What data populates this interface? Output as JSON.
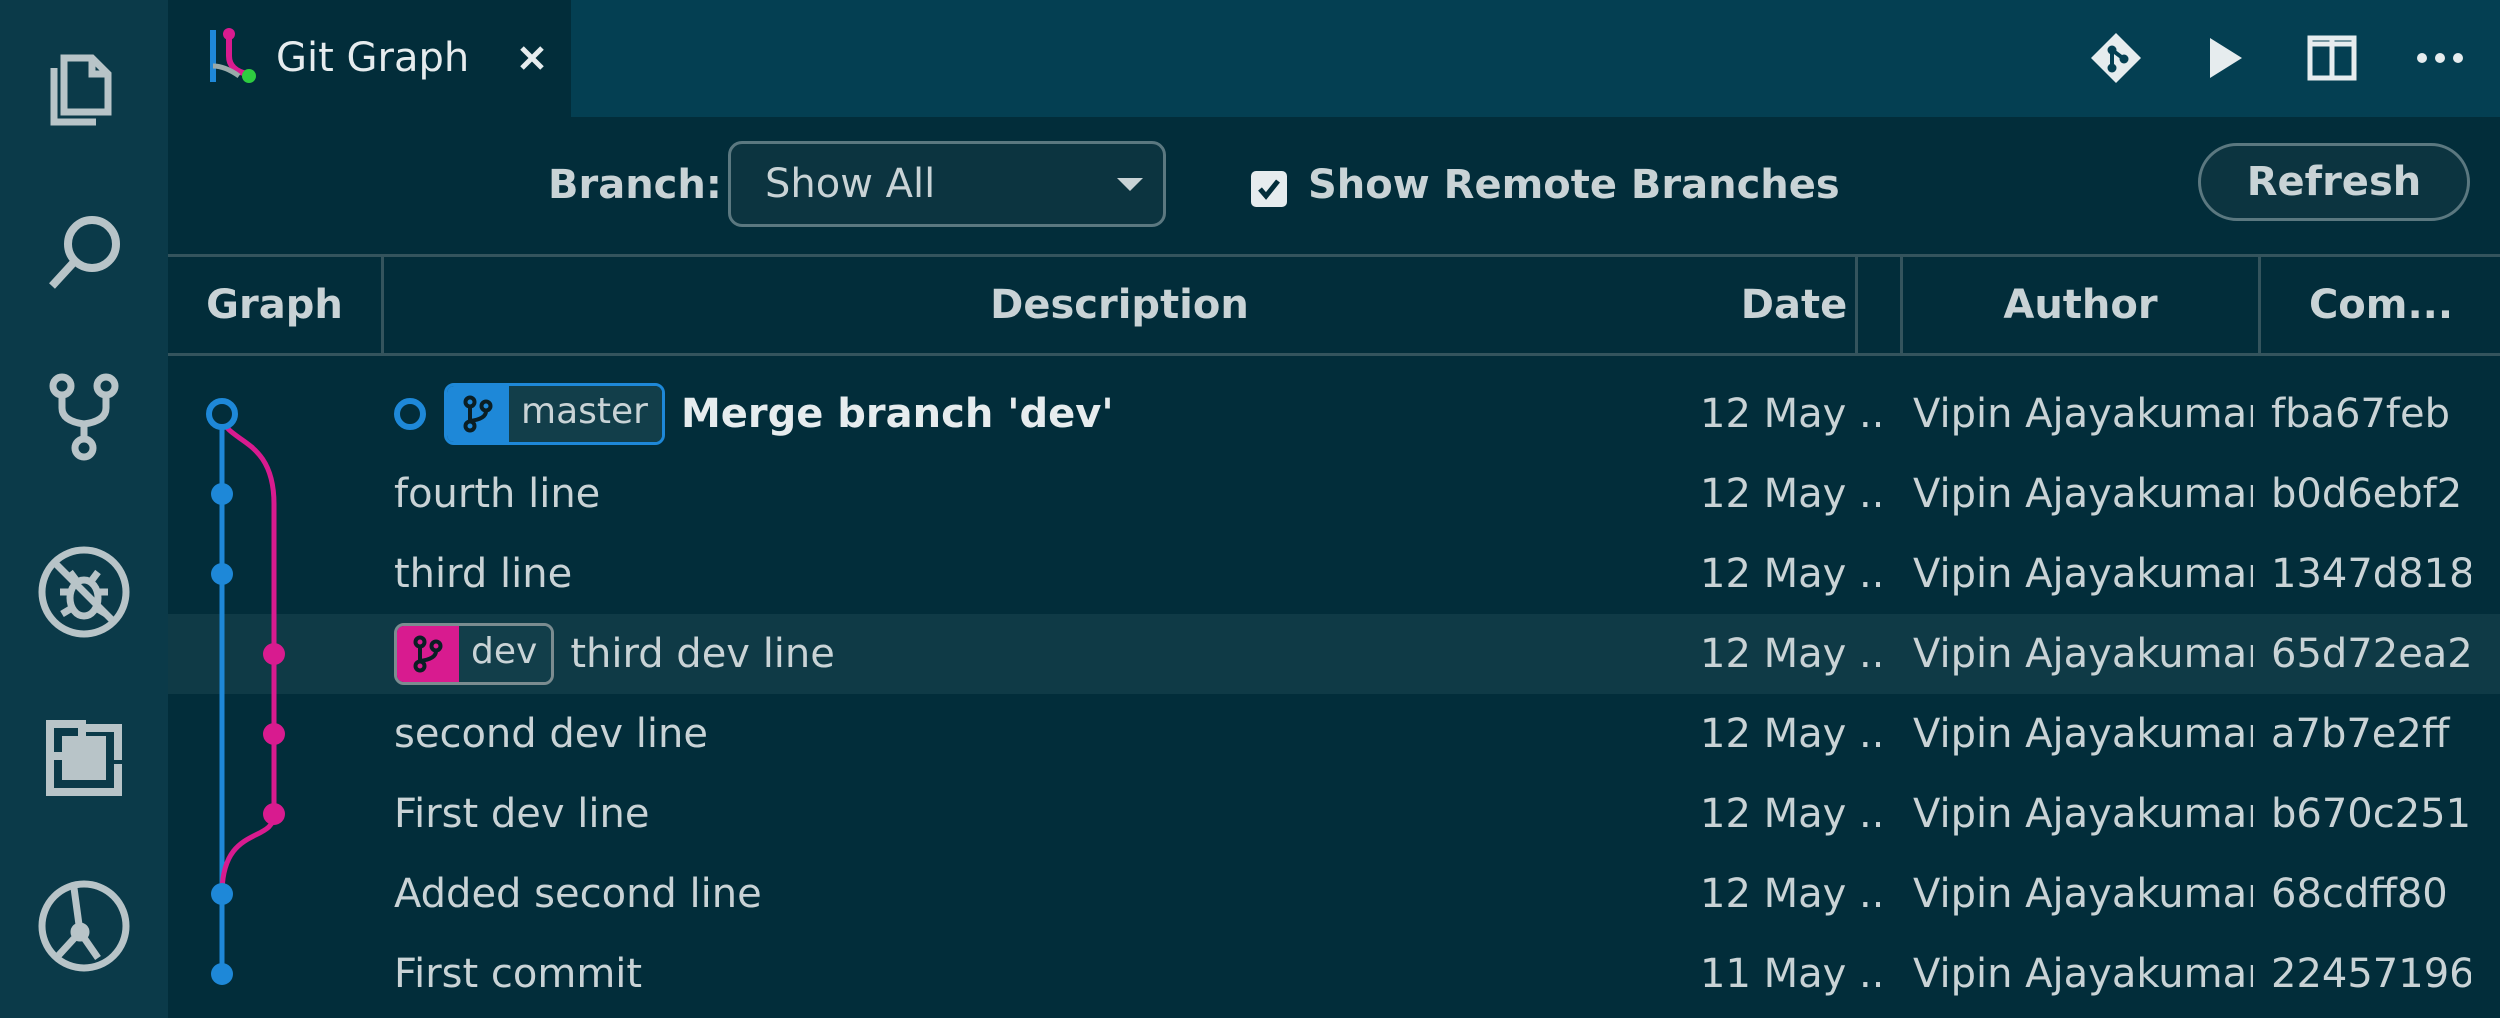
{
  "tab": {
    "title": "Git Graph",
    "close": "×"
  },
  "toolbar": {
    "icons": [
      "git-icon",
      "run-icon",
      "split-editor-icon",
      "more-icon"
    ]
  },
  "activity_bar": {
    "icons": [
      "explorer-icon",
      "search-icon",
      "source-control-icon",
      "debug-icon",
      "extensions-icon",
      "git-graph-icon"
    ]
  },
  "controls": {
    "branch_label": "Branch:",
    "branch_value": "Show All",
    "show_remote_label": "Show Remote Branches",
    "show_remote_checked": true,
    "refresh_label": "Refresh"
  },
  "columns": [
    "Graph",
    "Description",
    "Date",
    "Author",
    "Com..."
  ],
  "colors": {
    "master": "#1e88d8",
    "dev": "#d81b8f",
    "background": "#022d3a"
  },
  "commits": [
    {
      "ref": "master",
      "message": "Merge branch 'dev'",
      "date": "12 May ...",
      "author": "Vipin Ajayakumar",
      "hash": "fba67feb",
      "head": true
    },
    {
      "ref": "",
      "message": "fourth line",
      "date": "12 May ...",
      "author": "Vipin Ajayakumar",
      "hash": "b0d6ebf2"
    },
    {
      "ref": "",
      "message": "third line",
      "date": "12 May ...",
      "author": "Vipin Ajayakumar",
      "hash": "1347d818"
    },
    {
      "ref": "dev",
      "message": "third dev line",
      "date": "12 May ...",
      "author": "Vipin Ajayakumar",
      "hash": "65d72ea2",
      "selected": true
    },
    {
      "ref": "",
      "message": "second dev line",
      "date": "12 May ...",
      "author": "Vipin Ajayakumar",
      "hash": "a7b7e2ff"
    },
    {
      "ref": "",
      "message": "First dev line",
      "date": "12 May ...",
      "author": "Vipin Ajayakumar",
      "hash": "b670c251"
    },
    {
      "ref": "",
      "message": "Added second line",
      "date": "12 May ...",
      "author": "Vipin Ajayakumar",
      "hash": "68cdff80"
    },
    {
      "ref": "",
      "message": "First commit",
      "date": "11 May ...",
      "author": "Vipin Ajayakumar",
      "hash": "22457196"
    }
  ]
}
